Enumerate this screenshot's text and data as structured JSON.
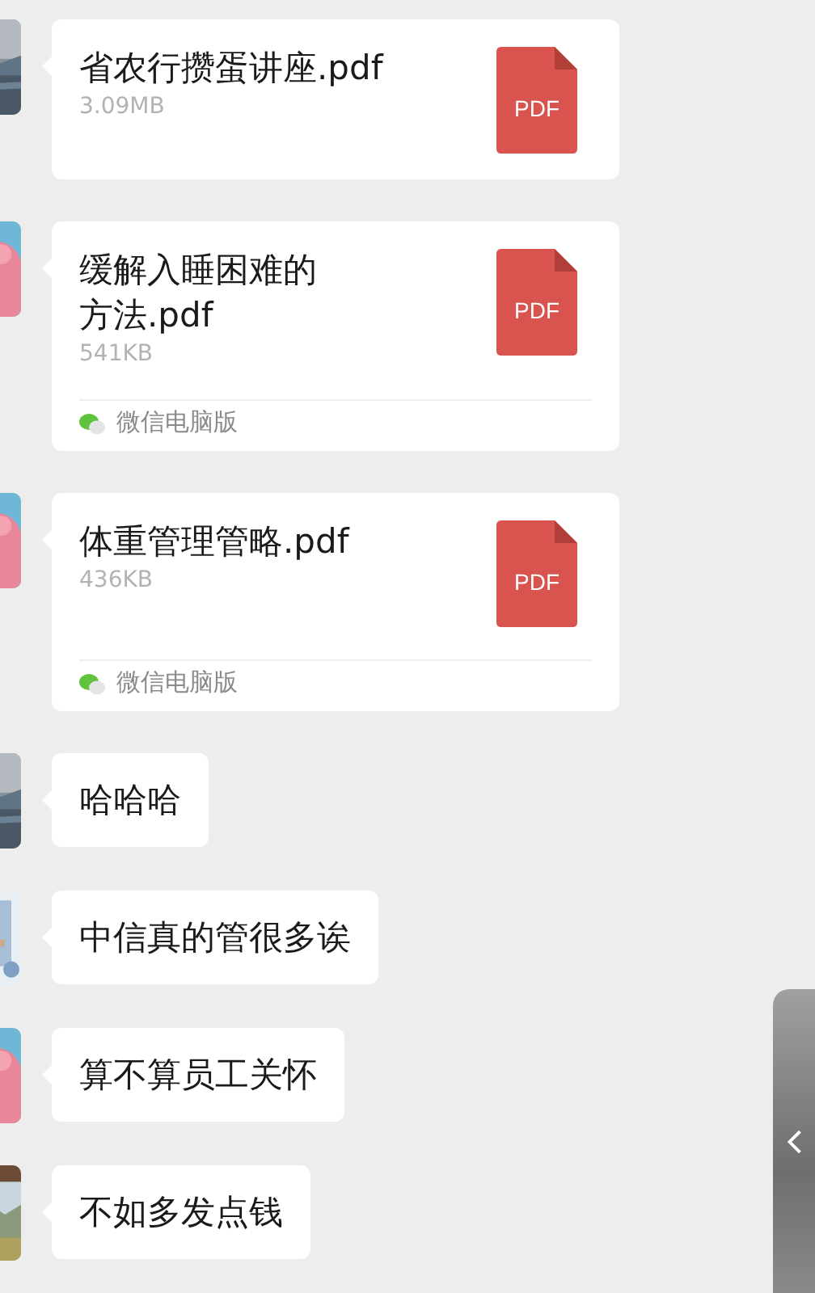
{
  "messages": [
    {
      "kind": "file",
      "title": "省农行攒蛋讲座.pdf",
      "size": "3.09MB",
      "file_type": "PDF"
    },
    {
      "kind": "file",
      "title_lines": [
        "缓解入睡困难的",
        "方法.pdf"
      ],
      "size": "541KB",
      "file_type": "PDF",
      "source": "微信电脑版"
    },
    {
      "kind": "file",
      "title": "体重管理管略.pdf",
      "size": "436KB",
      "file_type": "PDF",
      "source": "微信电脑版"
    },
    {
      "kind": "text",
      "text": "哈哈哈"
    },
    {
      "kind": "text",
      "text": "中信真的管很多诶"
    },
    {
      "kind": "text",
      "text": "算不算员工关怀"
    },
    {
      "kind": "text",
      "text": "不如多发点钱"
    }
  ]
}
